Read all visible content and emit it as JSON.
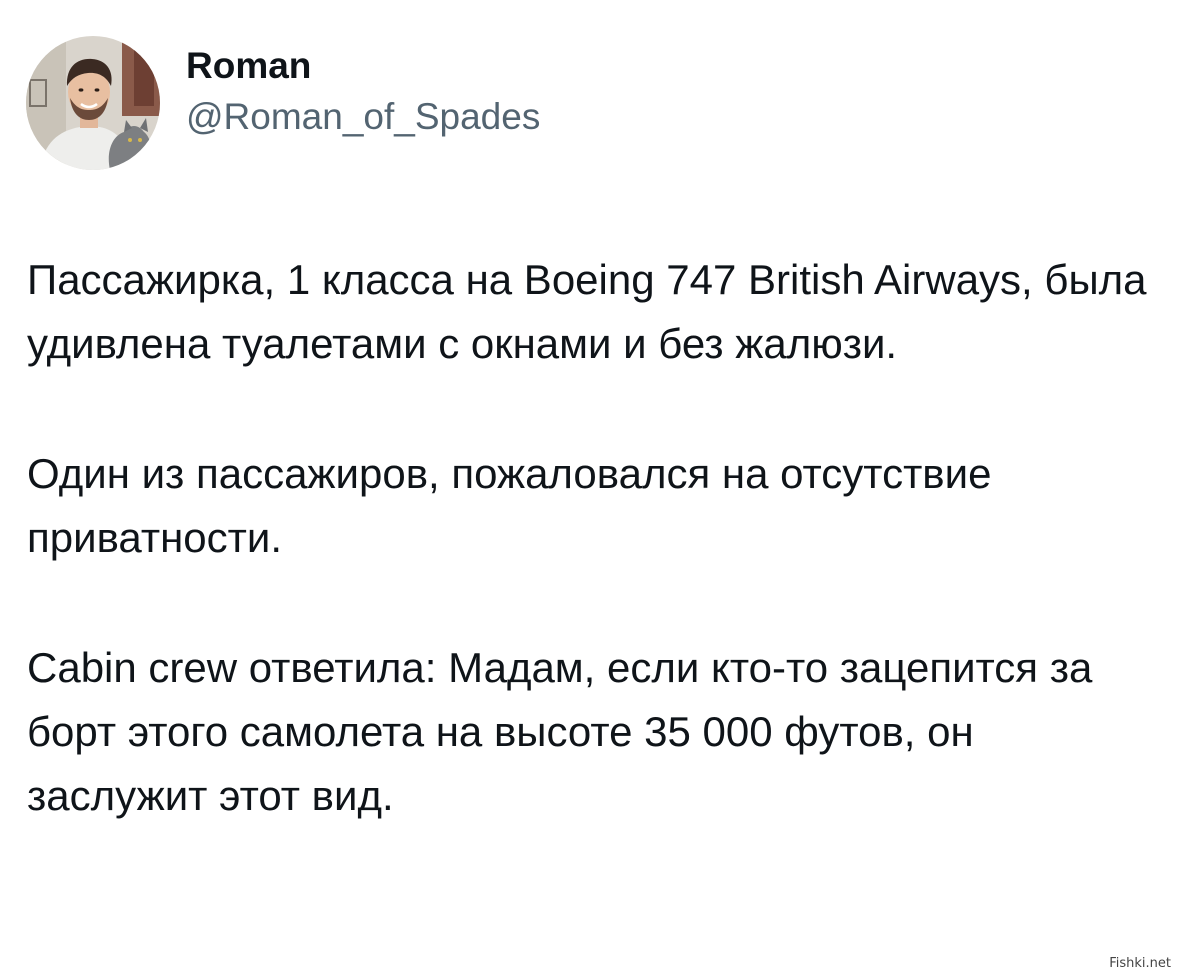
{
  "author": {
    "display_name": "Roman",
    "handle": "@Roman_of_Spades"
  },
  "tweet": {
    "paragraphs": [
      "Пассажирка, 1 класса на Boeing 747 British Airways, была удивлена туалетами с окнами и без жалюзи.",
      "Один из пассажиров, пожаловался на отсутствие приватности.",
      "Cabin crew ответила: Мадам, если кто-то зацепится за борт этого самолета на высоте 35 000 футов, он заслужит этот вид."
    ]
  },
  "watermark": "Fishki.net",
  "colors": {
    "text": "#0f1419",
    "secondary_text": "#536471",
    "background": "#ffffff"
  }
}
